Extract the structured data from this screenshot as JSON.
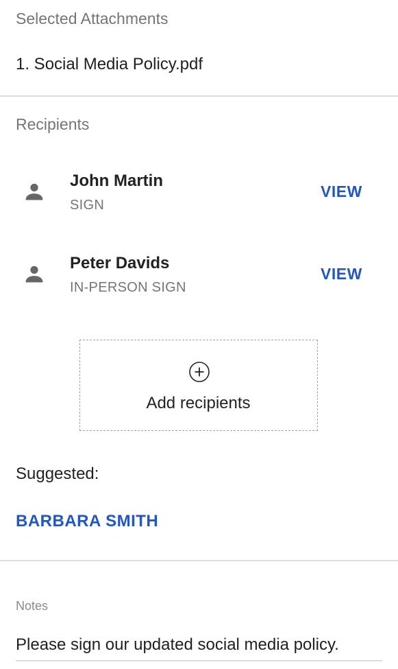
{
  "attachments": {
    "heading": "Selected Attachments",
    "items": [
      "1. Social Media Policy.pdf"
    ]
  },
  "recipients": {
    "heading": "Recipients",
    "items": [
      {
        "name": "John Martin",
        "role": "SIGN",
        "action": "VIEW",
        "icon": "person-icon"
      },
      {
        "name": "Peter Davids",
        "role": "IN-PERSON SIGN",
        "action": "VIEW",
        "icon": "person-icon"
      }
    ],
    "add_label": "Add recipients",
    "add_icon": "plus-circle-icon"
  },
  "suggested": {
    "label": "Suggested:",
    "items": [
      "BARBARA SMITH"
    ]
  },
  "notes": {
    "label": "Notes",
    "value": "Please sign our updated social media policy."
  },
  "colors": {
    "link": "#2256c1",
    "muted_text": "#757575",
    "divider": "#dddddd",
    "icon": "#666666"
  }
}
